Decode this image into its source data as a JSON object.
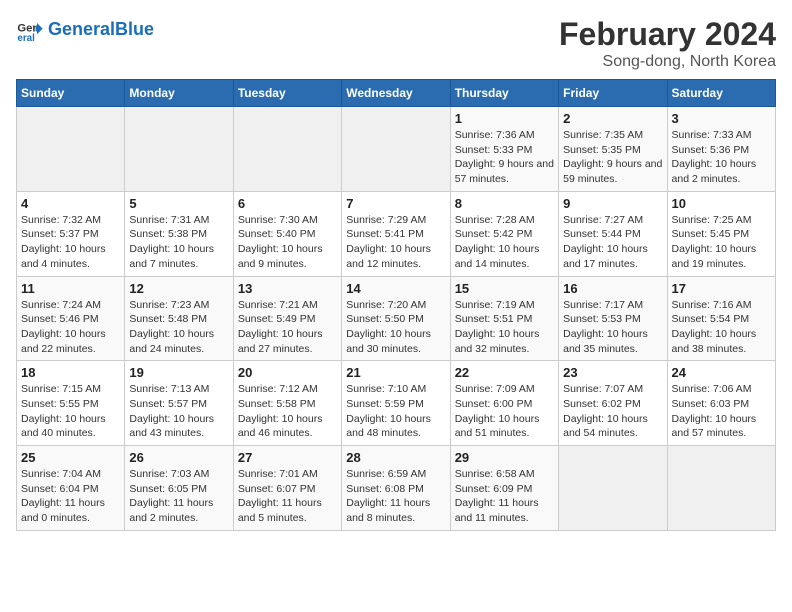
{
  "logo": {
    "line1": "General",
    "line2": "Blue"
  },
  "title": "February 2024",
  "subtitle": "Song-dong, North Korea",
  "days_of_week": [
    "Sunday",
    "Monday",
    "Tuesday",
    "Wednesday",
    "Thursday",
    "Friday",
    "Saturday"
  ],
  "weeks": [
    [
      {
        "day": "",
        "info": ""
      },
      {
        "day": "",
        "info": ""
      },
      {
        "day": "",
        "info": ""
      },
      {
        "day": "",
        "info": ""
      },
      {
        "day": "1",
        "info": "Sunrise: 7:36 AM\nSunset: 5:33 PM\nDaylight: 9 hours and 57 minutes."
      },
      {
        "day": "2",
        "info": "Sunrise: 7:35 AM\nSunset: 5:35 PM\nDaylight: 9 hours and 59 minutes."
      },
      {
        "day": "3",
        "info": "Sunrise: 7:33 AM\nSunset: 5:36 PM\nDaylight: 10 hours and 2 minutes."
      }
    ],
    [
      {
        "day": "4",
        "info": "Sunrise: 7:32 AM\nSunset: 5:37 PM\nDaylight: 10 hours and 4 minutes."
      },
      {
        "day": "5",
        "info": "Sunrise: 7:31 AM\nSunset: 5:38 PM\nDaylight: 10 hours and 7 minutes."
      },
      {
        "day": "6",
        "info": "Sunrise: 7:30 AM\nSunset: 5:40 PM\nDaylight: 10 hours and 9 minutes."
      },
      {
        "day": "7",
        "info": "Sunrise: 7:29 AM\nSunset: 5:41 PM\nDaylight: 10 hours and 12 minutes."
      },
      {
        "day": "8",
        "info": "Sunrise: 7:28 AM\nSunset: 5:42 PM\nDaylight: 10 hours and 14 minutes."
      },
      {
        "day": "9",
        "info": "Sunrise: 7:27 AM\nSunset: 5:44 PM\nDaylight: 10 hours and 17 minutes."
      },
      {
        "day": "10",
        "info": "Sunrise: 7:25 AM\nSunset: 5:45 PM\nDaylight: 10 hours and 19 minutes."
      }
    ],
    [
      {
        "day": "11",
        "info": "Sunrise: 7:24 AM\nSunset: 5:46 PM\nDaylight: 10 hours and 22 minutes."
      },
      {
        "day": "12",
        "info": "Sunrise: 7:23 AM\nSunset: 5:48 PM\nDaylight: 10 hours and 24 minutes."
      },
      {
        "day": "13",
        "info": "Sunrise: 7:21 AM\nSunset: 5:49 PM\nDaylight: 10 hours and 27 minutes."
      },
      {
        "day": "14",
        "info": "Sunrise: 7:20 AM\nSunset: 5:50 PM\nDaylight: 10 hours and 30 minutes."
      },
      {
        "day": "15",
        "info": "Sunrise: 7:19 AM\nSunset: 5:51 PM\nDaylight: 10 hours and 32 minutes."
      },
      {
        "day": "16",
        "info": "Sunrise: 7:17 AM\nSunset: 5:53 PM\nDaylight: 10 hours and 35 minutes."
      },
      {
        "day": "17",
        "info": "Sunrise: 7:16 AM\nSunset: 5:54 PM\nDaylight: 10 hours and 38 minutes."
      }
    ],
    [
      {
        "day": "18",
        "info": "Sunrise: 7:15 AM\nSunset: 5:55 PM\nDaylight: 10 hours and 40 minutes."
      },
      {
        "day": "19",
        "info": "Sunrise: 7:13 AM\nSunset: 5:57 PM\nDaylight: 10 hours and 43 minutes."
      },
      {
        "day": "20",
        "info": "Sunrise: 7:12 AM\nSunset: 5:58 PM\nDaylight: 10 hours and 46 minutes."
      },
      {
        "day": "21",
        "info": "Sunrise: 7:10 AM\nSunset: 5:59 PM\nDaylight: 10 hours and 48 minutes."
      },
      {
        "day": "22",
        "info": "Sunrise: 7:09 AM\nSunset: 6:00 PM\nDaylight: 10 hours and 51 minutes."
      },
      {
        "day": "23",
        "info": "Sunrise: 7:07 AM\nSunset: 6:02 PM\nDaylight: 10 hours and 54 minutes."
      },
      {
        "day": "24",
        "info": "Sunrise: 7:06 AM\nSunset: 6:03 PM\nDaylight: 10 hours and 57 minutes."
      }
    ],
    [
      {
        "day": "25",
        "info": "Sunrise: 7:04 AM\nSunset: 6:04 PM\nDaylight: 11 hours and 0 minutes."
      },
      {
        "day": "26",
        "info": "Sunrise: 7:03 AM\nSunset: 6:05 PM\nDaylight: 11 hours and 2 minutes."
      },
      {
        "day": "27",
        "info": "Sunrise: 7:01 AM\nSunset: 6:07 PM\nDaylight: 11 hours and 5 minutes."
      },
      {
        "day": "28",
        "info": "Sunrise: 6:59 AM\nSunset: 6:08 PM\nDaylight: 11 hours and 8 minutes."
      },
      {
        "day": "29",
        "info": "Sunrise: 6:58 AM\nSunset: 6:09 PM\nDaylight: 11 hours and 11 minutes."
      },
      {
        "day": "",
        "info": ""
      },
      {
        "day": "",
        "info": ""
      }
    ]
  ]
}
